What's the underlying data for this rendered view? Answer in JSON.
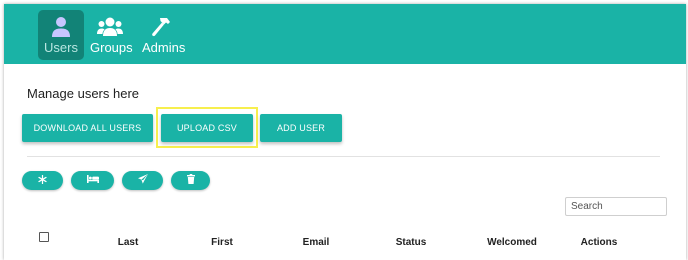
{
  "nav": {
    "items": [
      {
        "label": "Users",
        "icon": "user-icon",
        "active": true
      },
      {
        "label": "Groups",
        "icon": "group-icon",
        "active": false
      },
      {
        "label": "Admins",
        "icon": "hammer-icon",
        "active": false
      }
    ]
  },
  "main": {
    "description": "Manage users here",
    "buttons": {
      "download": "DOWNLOAD ALL USERS",
      "upload": "UPLOAD CSV",
      "add": "ADD USER"
    },
    "actions": [
      {
        "icon": "snowflake-icon"
      },
      {
        "icon": "bed-icon"
      },
      {
        "icon": "send-icon"
      },
      {
        "icon": "trash-icon"
      }
    ],
    "search": {
      "placeholder": "Search",
      "value": ""
    },
    "table": {
      "columns": [
        "Last",
        "First",
        "Email",
        "Status",
        "Welcomed",
        "Actions"
      ]
    }
  },
  "colors": {
    "primary": "#1ab3a6",
    "active_nav": "#128377",
    "highlight": "#f7ef4e"
  }
}
